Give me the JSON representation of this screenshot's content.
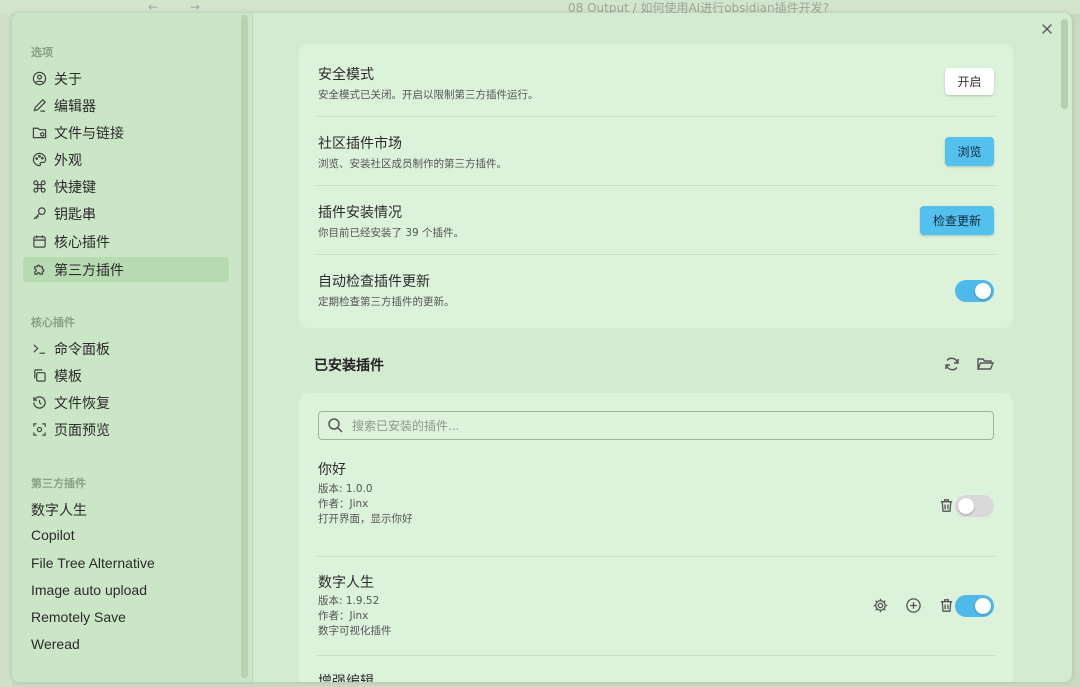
{
  "background": {
    "title": "08 Output / 如何使用AI进行obsidian插件开发?",
    "nav_arrows": "← →"
  },
  "sidebar": {
    "section_options": "选项",
    "options": [
      {
        "label": "关于",
        "icon": "info-icon"
      },
      {
        "label": "编辑器",
        "icon": "pencil-icon"
      },
      {
        "label": "文件与链接",
        "icon": "folder-icon"
      },
      {
        "label": "外观",
        "icon": "palette-icon"
      },
      {
        "label": "快捷键",
        "icon": "command-icon"
      },
      {
        "label": "钥匙串",
        "icon": "key-icon"
      },
      {
        "label": "核心插件",
        "icon": "calendar-icon"
      },
      {
        "label": "第三方插件",
        "icon": "puzzle-icon",
        "active": true
      }
    ],
    "section_core": "核心插件",
    "core_plugins": [
      {
        "label": "命令面板",
        "icon": "terminal-icon"
      },
      {
        "label": "模板",
        "icon": "copy-icon"
      },
      {
        "label": "文件恢复",
        "icon": "history-icon"
      },
      {
        "label": "页面预览",
        "icon": "preview-icon"
      }
    ],
    "section_third": "第三方插件",
    "third_plugins": [
      "数字人生",
      "Copilot",
      "File Tree Alternative",
      "Image auto upload",
      "Remotely Save",
      "Weread"
    ]
  },
  "settings": {
    "safe_mode": {
      "name": "安全模式",
      "desc": "安全模式已关闭。开启以限制第三方插件运行。",
      "button": "开启"
    },
    "community": {
      "name": "社区插件市场",
      "desc": "浏览、安装社区成员制作的第三方插件。",
      "button": "浏览"
    },
    "install_status": {
      "name": "插件安装情况",
      "desc": "你目前已经安装了 39 个插件。",
      "button": "检查更新"
    },
    "auto_check": {
      "name": "自动检查插件更新",
      "desc": "定期检查第三方插件的更新。",
      "toggle": "on"
    }
  },
  "installed": {
    "title": "已安装插件",
    "search_placeholder": "搜索已安装的插件...",
    "plugins": [
      {
        "name": "你好",
        "version": "版本: 1.0.0",
        "author": "作者：Jinx",
        "desc": "打开界面，显示你好",
        "enabled": false
      },
      {
        "name": "数字人生",
        "version": "版本: 1.9.52",
        "author": "作者：Jinx",
        "desc": "数字可视化插件",
        "enabled": true
      },
      {
        "name": "增强编辑"
      }
    ]
  },
  "colors": {
    "accent": "#54c0ee",
    "toggle_on": "#4fb9ea",
    "active_item": "#b8dab2"
  }
}
